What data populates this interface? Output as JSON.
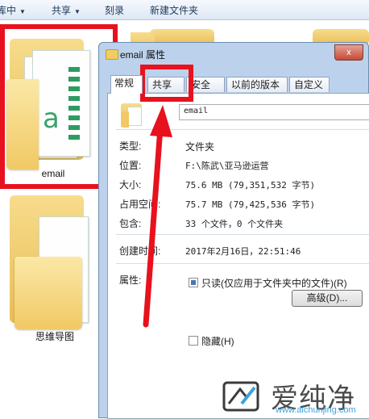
{
  "toolbar": {
    "items": [
      {
        "label": "库中",
        "caret": "▼"
      },
      {
        "label": "共享",
        "caret": "▼"
      },
      {
        "label": "刻录"
      },
      {
        "label": "新建文件夹"
      }
    ]
  },
  "explorer": {
    "folders": [
      {
        "name": "email",
        "icon": "folder-with-documents-icon"
      },
      {
        "name": "思维导图",
        "icon": "folder-with-documents-icon"
      }
    ]
  },
  "dialog": {
    "title": "email 属性",
    "close_glyph": "x",
    "tabs": [
      "常规",
      "共享",
      "安全",
      "以前的版本",
      "自定义"
    ],
    "name_value": "email",
    "props": [
      {
        "label": "类型:",
        "value": "文件夹"
      },
      {
        "label": "位置:",
        "value": "F:\\陈武\\亚马逊运营"
      },
      {
        "label": "大小:",
        "value": "75.6 MB (79,351,532 字节)"
      },
      {
        "label": "占用空间:",
        "value": "75.7 MB (79,425,536 字节)"
      },
      {
        "label": "包含:",
        "value": "33 个文件，0 个文件夹"
      },
      {
        "label": "创建时间:",
        "value": "2017年2月16日，22:51:46"
      }
    ],
    "attributes_label": "属性:",
    "readonly_label": "只读(仅应用于文件夹中的文件)(R)",
    "readonly_checked": true,
    "hidden_label": "隐藏(H)",
    "hidden_checked": false,
    "advanced_button": "高级(D)..."
  },
  "annotation": {
    "highlight_color": "#e8111e"
  },
  "watermark": {
    "brand": "爱纯净",
    "url": "www.aichunjing.com",
    "icon": "aichunjing-logo-icon"
  }
}
